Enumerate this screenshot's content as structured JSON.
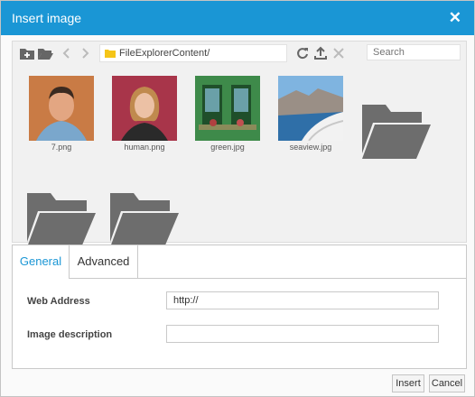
{
  "dialog": {
    "title": "Insert image",
    "close_glyph": "✕"
  },
  "toolbar": {
    "icons": [
      "new-folder-icon",
      "open-folder-icon",
      "back-icon",
      "forward-icon",
      "refresh-icon",
      "upload-icon",
      "delete-icon"
    ],
    "path": "FileExplorerContent/",
    "search_placeholder": "Search"
  },
  "files": [
    {
      "name": "7.png",
      "type": "image"
    },
    {
      "name": "human.png",
      "type": "image"
    },
    {
      "name": "green.jpg",
      "type": "image"
    },
    {
      "name": "seaview.jpg",
      "type": "image"
    },
    {
      "name": "",
      "type": "folder"
    },
    {
      "name": "",
      "type": "folder"
    },
    {
      "name": "",
      "type": "folder"
    }
  ],
  "tabs": [
    {
      "label": "General",
      "active": true
    },
    {
      "label": "Advanced",
      "active": false
    }
  ],
  "form": {
    "web_address_label": "Web Address",
    "web_address_value": "http://",
    "description_label": "Image description",
    "description_value": ""
  },
  "buttons": {
    "insert": "Insert",
    "cancel": "Cancel"
  },
  "colors": {
    "accent": "#1a96d5",
    "folder": "#6d6d6d",
    "path_folder": "#f5c518"
  }
}
